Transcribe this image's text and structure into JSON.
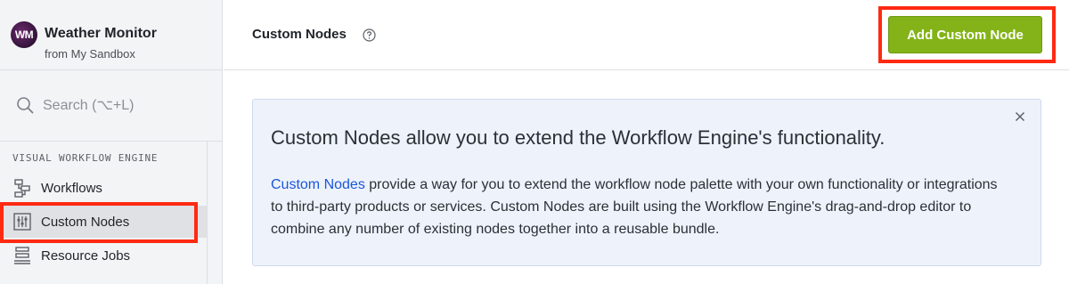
{
  "app": {
    "avatar_initials": "WM",
    "title": "Weather Monitor",
    "subtitle": "from My Sandbox"
  },
  "search": {
    "placeholder": "Search (⌥+L)"
  },
  "sidebar": {
    "section_label": "VISUAL WORKFLOW ENGINE",
    "items": [
      {
        "label": "Workflows",
        "icon": "workflow-icon",
        "active": false
      },
      {
        "label": "Custom Nodes",
        "icon": "sliders-icon",
        "active": true
      },
      {
        "label": "Resource Jobs",
        "icon": "resource-jobs-icon",
        "active": false
      }
    ]
  },
  "header": {
    "title": "Custom Nodes",
    "add_button_label": "Add Custom Node"
  },
  "info_card": {
    "heading": "Custom Nodes allow you to extend the Workflow Engine's functionality.",
    "link_text": "Custom Nodes",
    "body_text": " provide a way for you to extend the workflow node palette with your own functionality or integrations to third-party products or services. Custom Nodes are built using the Workflow Engine's drag-and-drop editor to combine any number of existing nodes together into a reusable bundle."
  },
  "colors": {
    "accent_button": "#83b318",
    "highlight": "#ff2a12",
    "link": "#1a56db",
    "info_background": "#eef3fb"
  }
}
